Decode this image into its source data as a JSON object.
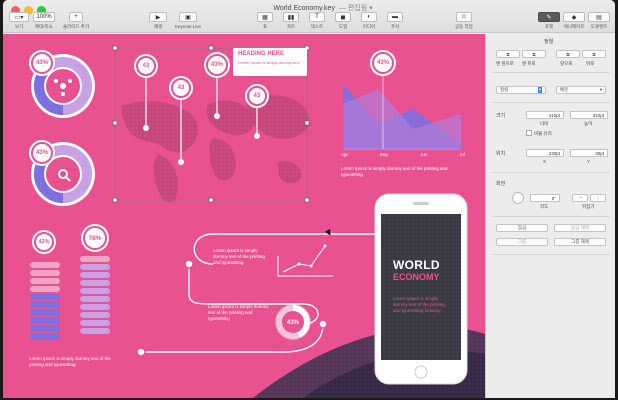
{
  "window": {
    "title": "World Economy.key",
    "subtitle": "— 편집됨 ▾"
  },
  "toolbar": {
    "view": "보기",
    "zoom_value": "100%",
    "zoom_label": "확대/축소",
    "add_slide": "슬라이드 추가",
    "play": "재생",
    "keynote_live": "Keynote Live",
    "table": "표",
    "chart": "차트",
    "text": "텍스트",
    "shape": "도형",
    "media": "미디어",
    "comment": "주석",
    "collaborate": "공동 작업",
    "format": "포맷",
    "animate": "애니메이트",
    "document": "도큐멘트"
  },
  "inspector": {
    "arrange_title": "정렬",
    "front": "맨 앞으로",
    "back": "맨 뒤로",
    "forward": "앞으로",
    "backward": "뒤로",
    "align": "정렬",
    "distribute": "배분",
    "size_label": "크기",
    "width": "410pt",
    "height": "322pt",
    "width_lbl": "너비",
    "height_lbl": "높이",
    "constrain": "비율 유지",
    "position_label": "위치",
    "x_val": "230pt",
    "y_val": "30pt",
    "x_lbl": "X",
    "y_lbl": "Y",
    "rotate_label": "회전",
    "angle_val": "0°",
    "angle_lbl": "각도",
    "flip_lbl": "뒤집기",
    "lock": "잠금",
    "unlock": "잠금 해제",
    "group": "그룹",
    "ungroup": "그룹 해제"
  },
  "slide": {
    "donut1_pct": "43%",
    "donut2_pct": "43%",
    "bar1_pct": "43%",
    "bar2_pct": "78%",
    "map_pin1": "43",
    "map_pin2": "43",
    "map_pin3": "43%",
    "map_pin4": "43",
    "map_heading": "HEADING HERE",
    "map_body": "Lorem Ipsum is simply dummy text",
    "area_pct": "43%",
    "area_x_labels": [
      "Apr",
      "May",
      "Jun",
      "Jul"
    ],
    "area_caption": "Lorem Ipsum is simply dummy text of the printing and typesetting",
    "flow_text1": "Lorem ipsum is simply dummy text of the printing and typesetting",
    "flow_text2": "Lorem ipsum is simply dummy text of the printing and typesetting",
    "flow_pct": "43%",
    "bars_caption": "Lorem Ipsum is simply dummy text of the printing and typesetting",
    "phone_title1": "WORLD",
    "phone_title2": "ECONOMY",
    "phone_body": "Lorem Ipsum is simply dummy text of the printing and typesetting industry"
  },
  "colors": {
    "canvas": "#e8508f",
    "accent_purple": "#7b6fe0",
    "light_purple": "#c9a0e6",
    "white": "#ffffff"
  }
}
